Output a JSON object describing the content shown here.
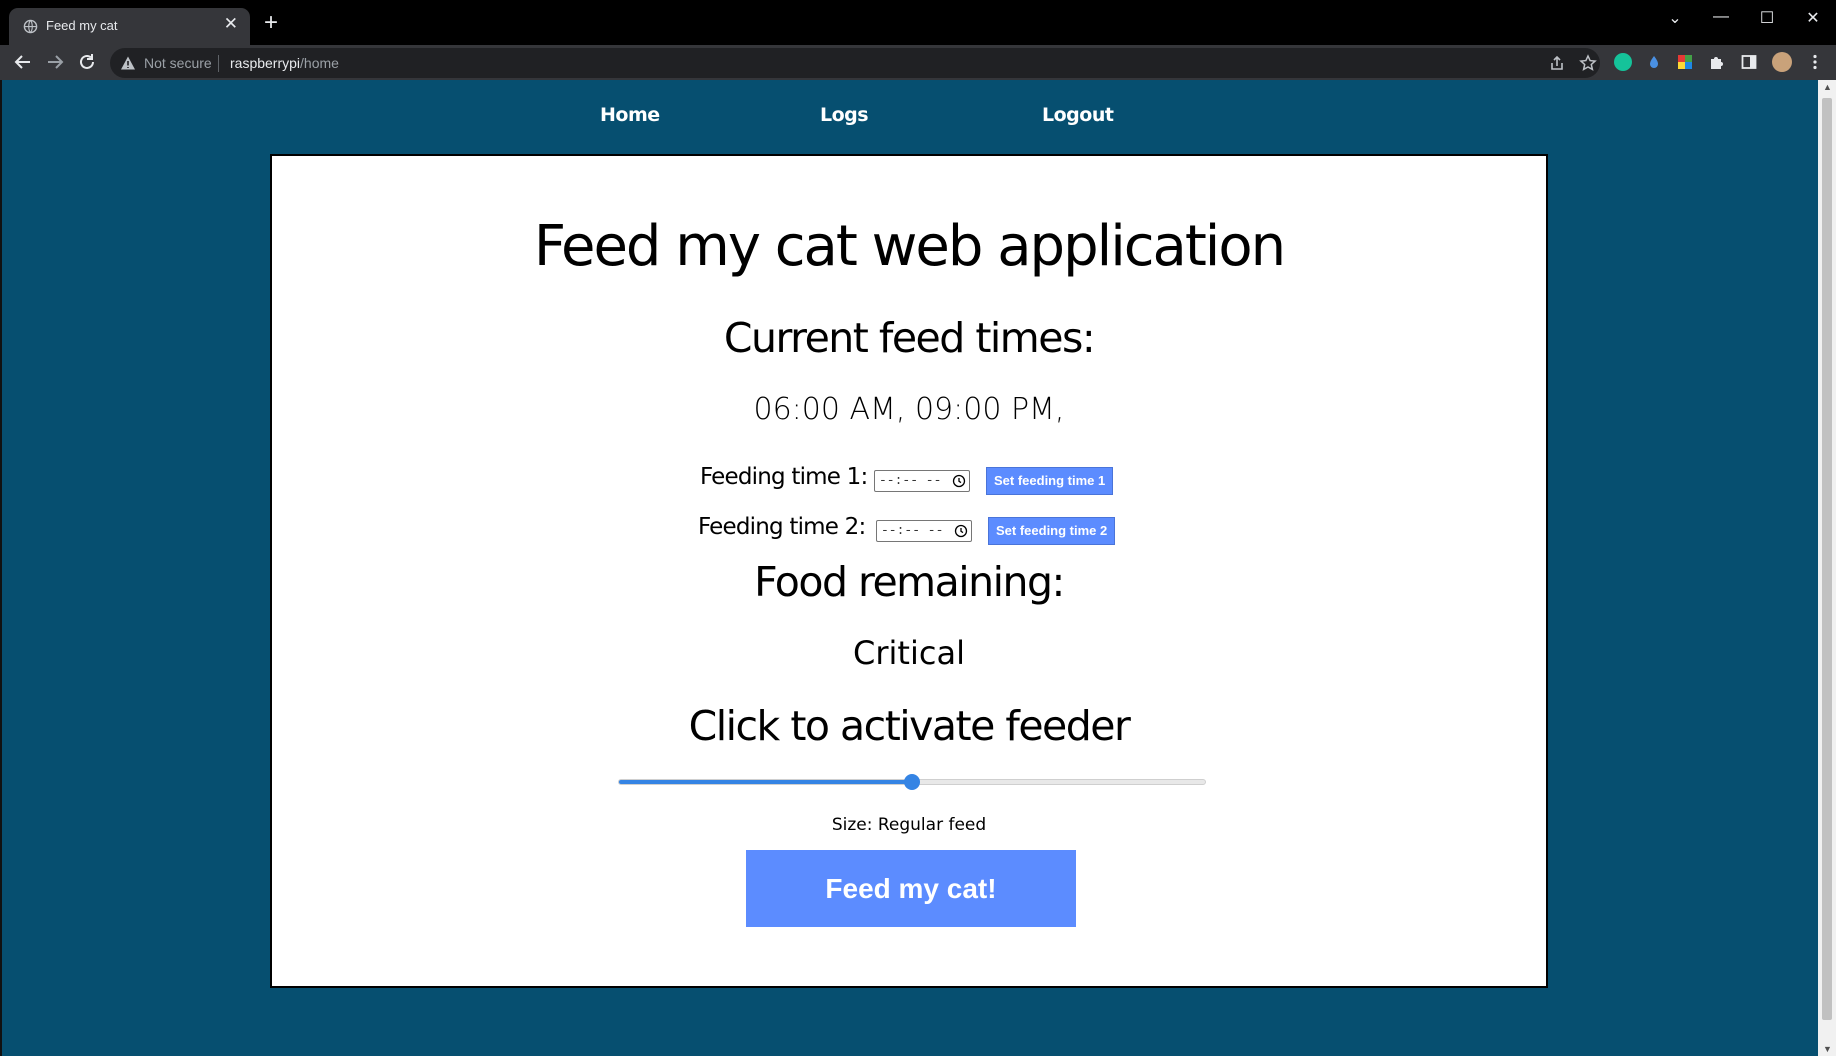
{
  "browser": {
    "tab_title": "Feed my cat",
    "new_tab": "+",
    "tab_close": "✕",
    "security": "Not secure",
    "url_host": "raspberrypi",
    "url_path": "/home"
  },
  "nav": {
    "home": "Home",
    "logs": "Logs",
    "logout": "Logout"
  },
  "page": {
    "title": "Feed my cat web application",
    "current_feed_heading": "Current feed times:",
    "current_feed_times": "06:00 AM, 09:00 PM,",
    "feeding_time_1_label": "Feeding time 1:",
    "feeding_time_2_label": "Feeding time 2:",
    "time_input_placeholder": "--:-- --",
    "set_time_1_label": "Set feeding time 1",
    "set_time_2_label": "Set feeding time 2",
    "food_heading": "Food remaining:",
    "food_status": "Critical",
    "activate_heading": "Click to activate feeder",
    "slider_value_pct": 50,
    "size_label": "Size:",
    "size_value": "Regular feed",
    "feed_button": "Feed my cat!"
  },
  "colors": {
    "page_bg": "#064f70",
    "button_blue": "#5c8cff",
    "slider_accent": "#3584e4"
  }
}
